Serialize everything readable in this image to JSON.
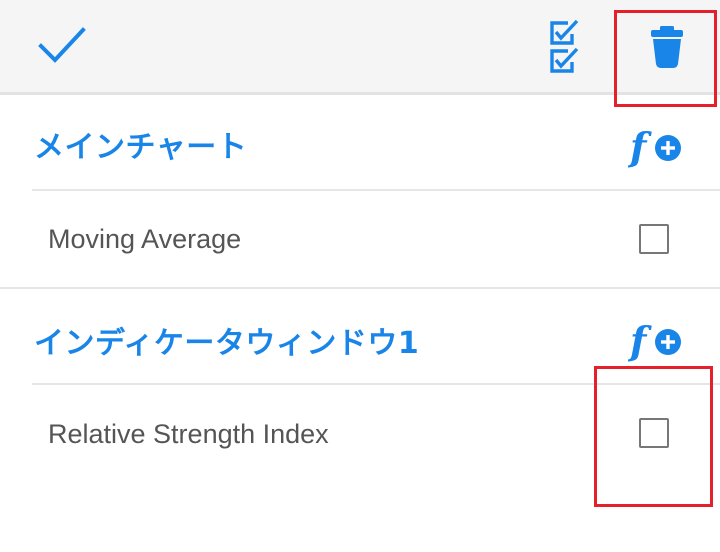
{
  "toolbar": {
    "confirm_icon": "checkmark-icon",
    "select_all_icon": "double-checklist-icon",
    "delete_icon": "trash-icon",
    "accent_color": "#1a85e8"
  },
  "sections": [
    {
      "title": "メインチャート",
      "add_icon": "function-add-icon",
      "items": [
        {
          "label": "Moving Average",
          "checked": false
        }
      ]
    },
    {
      "title": "インディケータウィンドウ1",
      "add_icon": "function-add-icon",
      "items": [
        {
          "label": "Relative Strength Index",
          "checked": false
        }
      ]
    }
  ],
  "highlight_color": "#e5202a"
}
